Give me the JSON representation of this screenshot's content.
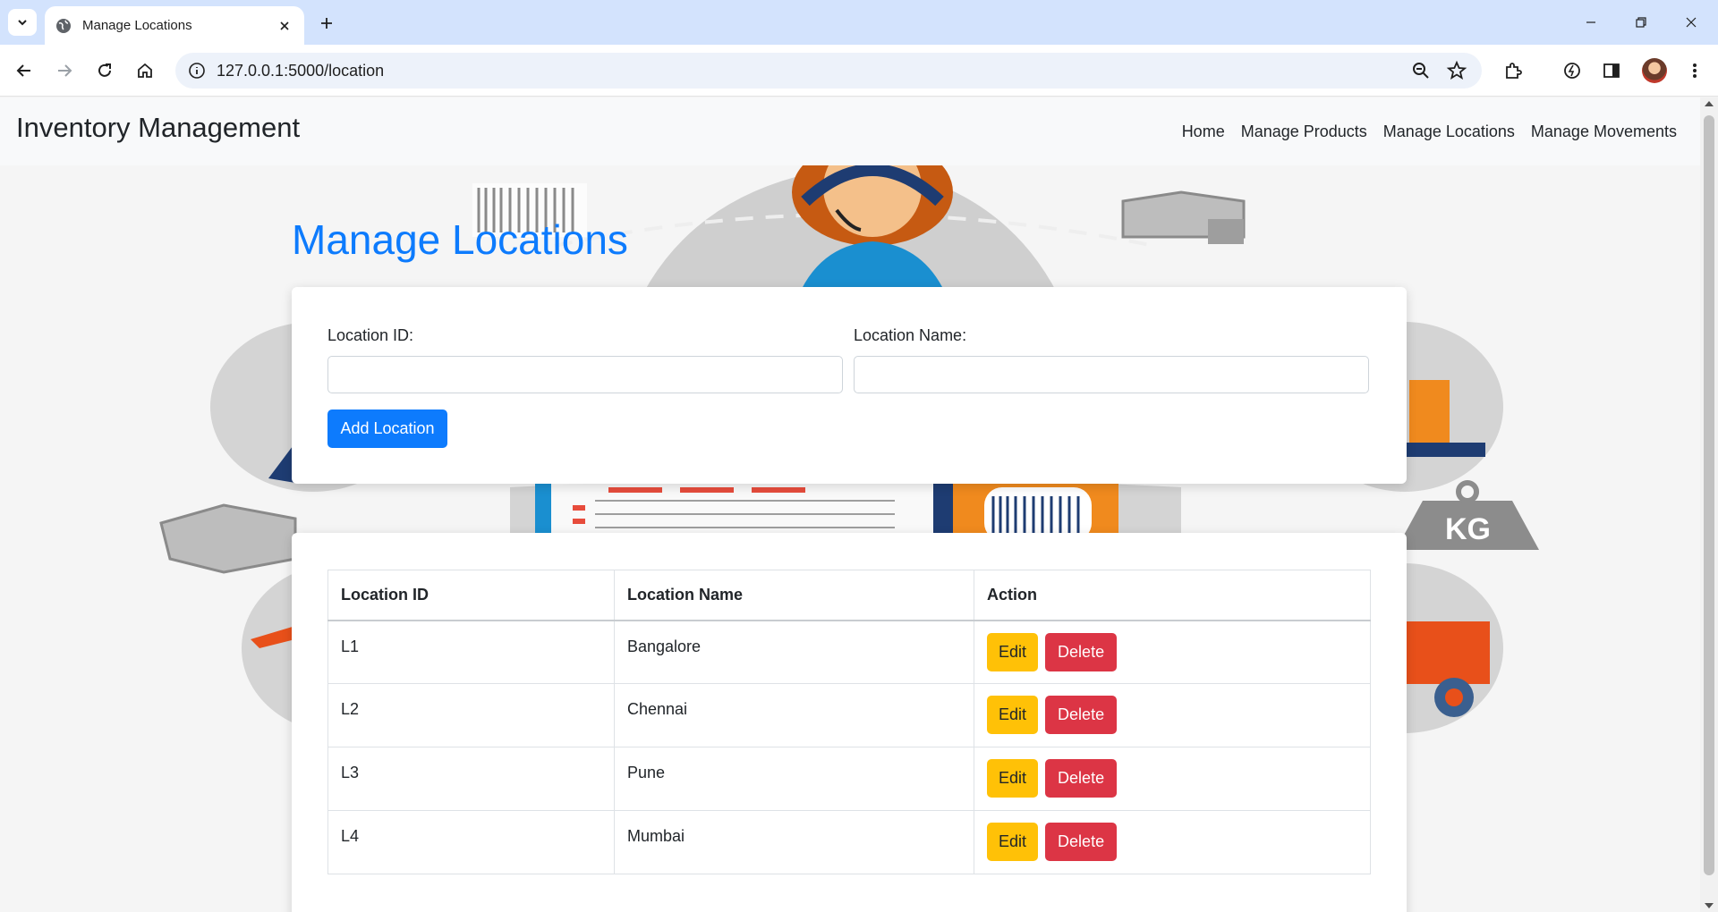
{
  "browser": {
    "tab_title": "Manage Locations",
    "url": "127.0.0.1:5000/location"
  },
  "navbar": {
    "brand": "Inventory Management",
    "links": [
      "Home",
      "Manage Products",
      "Manage Locations",
      "Manage Movements"
    ]
  },
  "page": {
    "title": "Manage Locations"
  },
  "form": {
    "location_id_label": "Location ID:",
    "location_id_value": "",
    "location_name_label": "Location Name:",
    "location_name_value": "",
    "add_button": "Add Location"
  },
  "table": {
    "headers": [
      "Location ID",
      "Location Name",
      "Action"
    ],
    "rows": [
      {
        "id": "L1",
        "name": "Bangalore"
      },
      {
        "id": "L2",
        "name": "Chennai"
      },
      {
        "id": "L3",
        "name": "Pune"
      },
      {
        "id": "L4",
        "name": "Mumbai"
      }
    ],
    "edit_label": "Edit",
    "delete_label": "Delete"
  },
  "colors": {
    "primary": "#0d7bfd",
    "warning": "#ffc107",
    "danger": "#dc3545",
    "tabstrip": "#d3e3fd"
  }
}
